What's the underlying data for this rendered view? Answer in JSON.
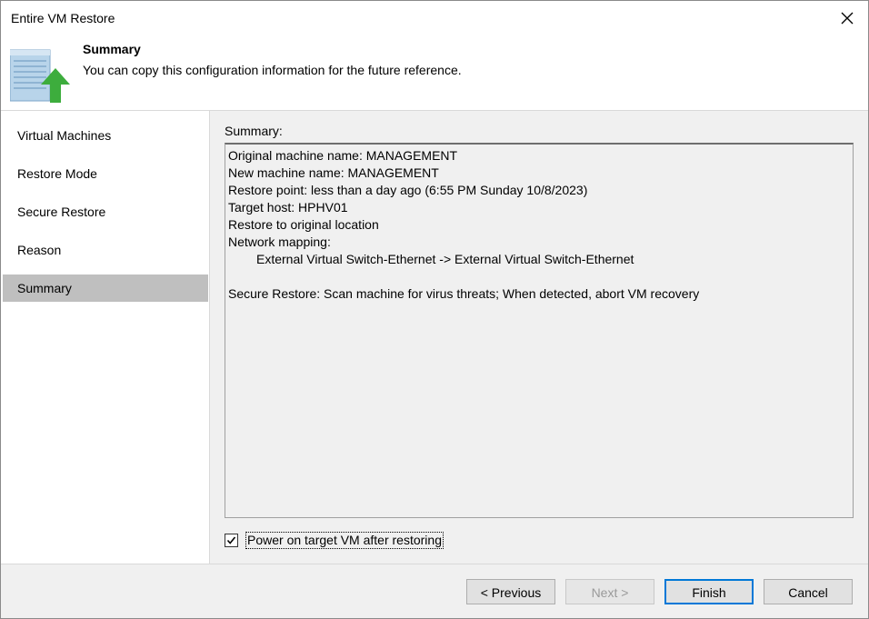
{
  "window": {
    "title": "Entire VM Restore"
  },
  "header": {
    "title": "Summary",
    "subtitle": "You can copy this configuration information for the future reference."
  },
  "sidebar": {
    "items": [
      {
        "label": "Virtual Machines",
        "active": false
      },
      {
        "label": "Restore Mode",
        "active": false
      },
      {
        "label": "Secure Restore",
        "active": false
      },
      {
        "label": "Reason",
        "active": false
      },
      {
        "label": "Summary",
        "active": true
      }
    ]
  },
  "summary": {
    "label": "Summary:",
    "lines": [
      "Original machine name: MANAGEMENT",
      "New machine name: MANAGEMENT",
      "Restore point: less than a day ago (6:55 PM Sunday 10/8/2023)",
      "Target host: HPHV01",
      "Restore to original location",
      "Network mapping:",
      "External Virtual Switch-Ethernet -> External Virtual Switch-Ethernet",
      "",
      "Secure Restore: Scan machine for virus threats; When detected, abort VM recovery"
    ]
  },
  "power_on": {
    "label": "Power on target VM after restoring",
    "checked": true
  },
  "buttons": {
    "previous": "< Previous",
    "next": "Next >",
    "finish": "Finish",
    "cancel": "Cancel"
  },
  "colors": {
    "accent": "#0078d7",
    "arrow": "#3dad3d",
    "active_nav": "#bfbfbf"
  }
}
